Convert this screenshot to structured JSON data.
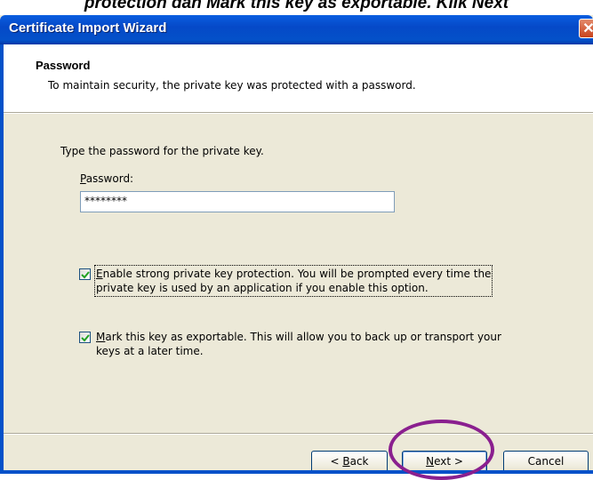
{
  "caption": {
    "text": "protection dan Mark this key as exportable. Klik Next"
  },
  "window": {
    "title": "Certificate Import Wizard"
  },
  "header": {
    "title": "Password",
    "subtitle": "To maintain security, the private key was protected with a password."
  },
  "body": {
    "prompt": "Type the password for the private key.",
    "password_label_first": "P",
    "password_label_rest": "assword:",
    "password_value": "********"
  },
  "options": {
    "strong_protection": {
      "checked": true,
      "first": "E",
      "line1_rest": "nable strong private key protection. You will be prompted every time the",
      "line2": "private key is used by an application if you enable this option."
    },
    "exportable": {
      "checked": true,
      "first": "M",
      "line1_rest": "ark this key as exportable. This will allow you to back up or transport your",
      "line2": "keys at a later time."
    }
  },
  "buttons": {
    "back_pre": "< ",
    "back_accel": "B",
    "back_post": "ack",
    "next_accel": "N",
    "next_post": "ext >",
    "cancel": "Cancel"
  },
  "colors": {
    "titlebar": "#0451c9",
    "dialog_bg": "#ece9d8",
    "highlight": "#8a1f8f"
  }
}
